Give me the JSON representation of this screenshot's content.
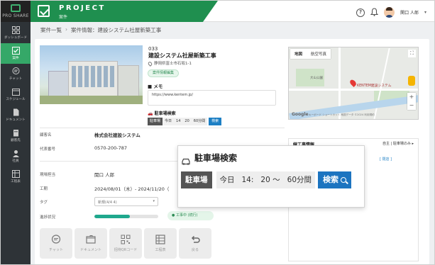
{
  "app": {
    "logo_text": "PRO SHARE"
  },
  "sidebar": {
    "items": [
      {
        "label": "ダッシュボード",
        "icon": "grid-icon",
        "active": false
      },
      {
        "label": "案件",
        "icon": "project-icon",
        "active": true
      },
      {
        "label": "チャット",
        "icon": "chat-icon",
        "active": false
      },
      {
        "label": "スケジュール",
        "icon": "calendar-icon",
        "active": false
      },
      {
        "label": "ドキュメント",
        "icon": "document-icon",
        "active": false
      },
      {
        "label": "顧客先",
        "icon": "building-icon",
        "active": false
      },
      {
        "label": "社員",
        "icon": "person-icon",
        "active": false
      },
      {
        "label": "工程表",
        "icon": "table-icon",
        "active": false
      }
    ]
  },
  "header": {
    "title": "PROJECT",
    "subtitle": "案件",
    "user_name": "関口 人郎",
    "help_icon": "question-circle-icon",
    "bell_icon": "bell-icon"
  },
  "breadcrumb": {
    "root": "案件一覧",
    "separator": "›",
    "current": "案件情報：建設システム社屋新築工事"
  },
  "project": {
    "id": "033",
    "name": "建設システム社屋新築工事",
    "address": "静岡県富士市石坂1-1",
    "edit_tag": "案件情報編集",
    "memo_label": "メモ",
    "memo_url": "https://www.kentem.jp/",
    "parking_label": "駐車場検索",
    "parking": {
      "tag": "駐車場",
      "day": "今日",
      "hour": "14",
      "minute": "20",
      "tilde": "～",
      "duration": "60分間",
      "search": "検索"
    }
  },
  "details": [
    {
      "key": "顧客名",
      "value": "株式会社建設システム",
      "bold": true
    },
    {
      "key": "代表番号",
      "value": "0570-200-787",
      "bold": false
    },
    {
      "key": "現場担当",
      "value": "関口 人郎",
      "bold": false
    },
    {
      "key": "工期",
      "value": "2024/08/01（木）- 2024/11/20（",
      "bold": false
    },
    {
      "key": "タグ",
      "value": "",
      "bold": false
    },
    {
      "key": "進捗状況",
      "value": "",
      "bold": false
    }
  ],
  "tag_select": {
    "value": "新規(4/4 4)"
  },
  "progress": {
    "fraction": 0.55,
    "status": "工事中 (続行)",
    "color": "#1fa88d"
  },
  "actions": [
    {
      "label": "チャット",
      "icon": "chat-bubble-icon"
    },
    {
      "label": "ドキュメント",
      "icon": "folder-icon"
    },
    {
      "label": "招待QRコード",
      "icon": "qr-code-icon"
    },
    {
      "label": "工程表",
      "icon": "schedule-table-icon"
    },
    {
      "label": "戻る",
      "icon": "return-arrow-icon"
    }
  ],
  "map": {
    "tab_map": "地図",
    "tab_satellite": "航空写真",
    "marker_label": "KENTEM建設システム",
    "place_label": "大山公園",
    "google": "Google",
    "credit": "キーボード ショートカット  地図データ ©2024  利用規約"
  },
  "side_panel": {
    "title": "線工事情報",
    "right": "自主 | 駐車場のみ ▸",
    "link": "[ 閉店 ]"
  },
  "colors": {
    "accent": "#1f8f4f",
    "active_nav": "#35a868",
    "button_blue": "#1c74c0"
  }
}
